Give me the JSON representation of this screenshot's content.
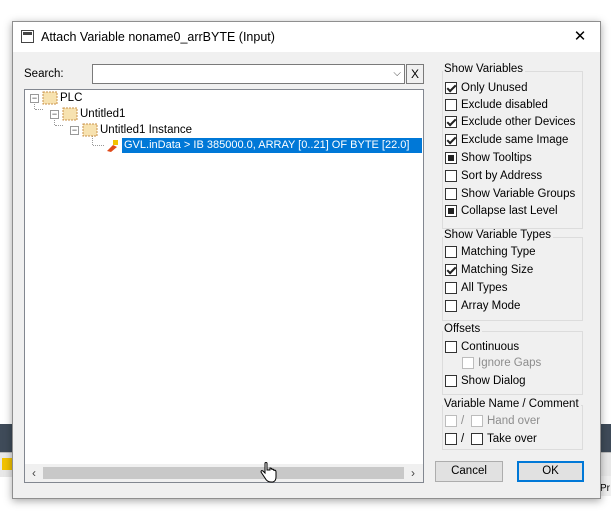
{
  "dialog": {
    "title": "Attach Variable noname0_arrBYTE (Input)",
    "close_glyph": "✕"
  },
  "search": {
    "label": "Search:",
    "value": "",
    "clear_glyph": "X",
    "chevron_glyph": "⌵"
  },
  "tree": {
    "nodes": [
      {
        "label": "PLC",
        "icon": "plc-icon",
        "expanded": true
      },
      {
        "label": "Untitled1",
        "icon": "project-icon",
        "expanded": true
      },
      {
        "label": "Untitled1 Instance",
        "icon": "instance-icon",
        "expanded": true
      },
      {
        "label": "GVL.inData    >    IB 385000.0, ARRAY [0..21] OF BYTE [22.0]",
        "icon": "variable-icon",
        "selected": true
      }
    ]
  },
  "show_variables": {
    "title": "Show Variables",
    "items": [
      {
        "label": "Only Unused",
        "state": "checked"
      },
      {
        "label": "Exclude disabled",
        "state": "unchecked"
      },
      {
        "label": "Exclude other Devices",
        "state": "checked"
      },
      {
        "label": "Exclude same Image",
        "state": "checked"
      },
      {
        "label": "Show Tooltips",
        "state": "filled"
      },
      {
        "label": "Sort by Address",
        "state": "unchecked"
      },
      {
        "label": "Show Variable Groups",
        "state": "unchecked"
      },
      {
        "label": "Collapse last Level",
        "state": "filled"
      }
    ]
  },
  "show_variable_types": {
    "title": "Show Variable Types",
    "items": [
      {
        "label": "Matching Type",
        "state": "unchecked"
      },
      {
        "label": "Matching Size",
        "state": "checked"
      },
      {
        "label": "All Types",
        "state": "unchecked"
      },
      {
        "label": "Array Mode",
        "state": "unchecked"
      }
    ]
  },
  "offsets": {
    "title": "Offsets",
    "continuous": "Continuous",
    "ignore_gaps": "Ignore Gaps",
    "show_dialog": "Show Dialog"
  },
  "var_name_comment": {
    "title": "Variable Name / Comment",
    "separator": "/",
    "hand_over": "Hand over",
    "take_over": "Take over"
  },
  "buttons": {
    "cancel": "Cancel",
    "ok": "OK"
  },
  "background": {
    "partial_text": "Pr"
  },
  "colors": {
    "selection": "#0078d7",
    "dialog_bg": "#f0f0f0"
  }
}
